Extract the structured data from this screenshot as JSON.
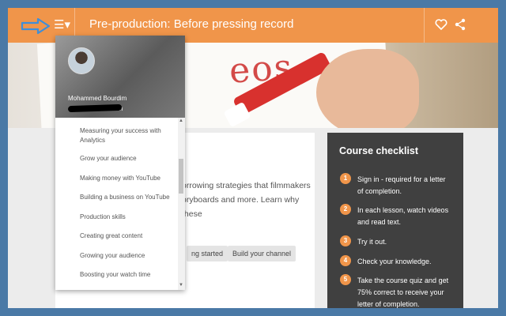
{
  "header": {
    "title": "Pre-production: Before pressing record",
    "menu_icon": "☰▾",
    "accent_color": "#f0954a"
  },
  "hero": {
    "scribble_text": "eos"
  },
  "drawer": {
    "user_name": "Mohammed Bourdim",
    "user_email_suffix": "om",
    "items": [
      {
        "label": "Measuring your success with Analytics"
      },
      {
        "label": "Grow your audience"
      },
      {
        "label": "Making money with YouTube"
      },
      {
        "label": "Building a business on YouTube"
      },
      {
        "label": "Production skills"
      },
      {
        "label": "Creating great content"
      },
      {
        "label": "Growing your audience"
      },
      {
        "label": "Boosting your watch time"
      }
    ]
  },
  "main": {
    "description_line1": "orrowing strategies that filmmakers",
    "description_line2": "oryboards and more. Learn why these",
    "chip_getting_started": "ng started",
    "chip_build_channel": "Build your channel"
  },
  "checklist": {
    "title": "Course checklist",
    "items": [
      {
        "num": "1",
        "text": "Sign in - required for a letter of completion."
      },
      {
        "num": "2",
        "text": "In each lesson, watch videos and read text."
      },
      {
        "num": "3",
        "text": "Try it out."
      },
      {
        "num": "4",
        "text": "Check your knowledge."
      },
      {
        "num": "5",
        "text": "Take the course quiz and get 75% correct to receive your letter of completion."
      }
    ]
  }
}
